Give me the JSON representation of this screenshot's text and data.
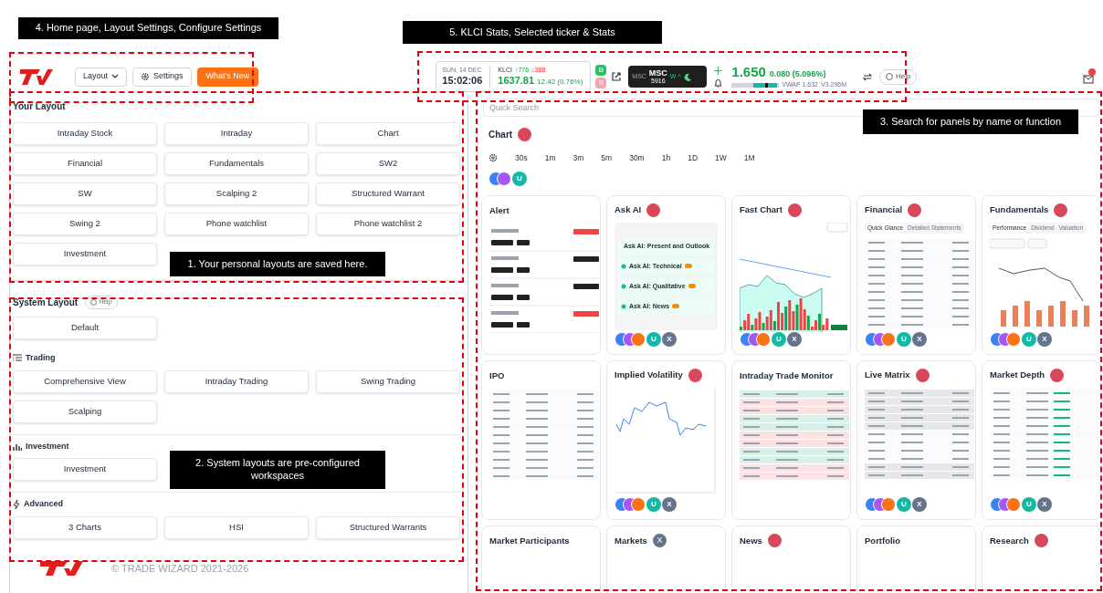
{
  "annotations": [
    {
      "text": "4. Home page, Layout Settings, Configure Settings"
    },
    {
      "text": "5. KLCI Stats, Selected ticker & Stats"
    },
    {
      "text": "3. Search for panels by name or function"
    },
    {
      "text": "1. Your personal layouts are saved here."
    },
    {
      "text": "2. System layouts are pre-configured workspaces"
    }
  ],
  "header": {
    "buttons": [
      {
        "label": "Layout",
        "kind": "dropdown"
      },
      {
        "label": "Settings",
        "kind": "settings"
      },
      {
        "label": "What's New",
        "kind": "primary"
      }
    ],
    "klci": {
      "date": "SUN, 14 DEC",
      "time": "15:02:06",
      "label": "KLCI",
      "up": "↑776",
      "down": "↓388",
      "value": "1637.81",
      "change": "12.42 (0.76%)"
    },
    "trade_badges": [
      {
        "label": "B",
        "color": "#22c55e"
      },
      {
        "label": "S",
        "color": "#f4a3b0"
      }
    ],
    "ticker": {
      "market": "MSC",
      "name": "MSC",
      "code": "5916",
      "flags": "W ^"
    },
    "price": {
      "last": "1.650",
      "change": "0.080 (5.096%)",
      "vwap": "VWAP 1.632",
      "volume": "V3.296M"
    },
    "help": "Help"
  },
  "your_layout": {
    "title": "Your Layout",
    "items": [
      "Intraday Stock",
      "Intraday",
      "Chart",
      "Financial",
      "Fundamentals",
      "SW2",
      "SW",
      "Scalping 2",
      "Structured Warrant",
      "Swing 2",
      "Phone watchlist",
      "Phone watchlist 2",
      "Investment"
    ]
  },
  "system_layout": {
    "title": "System Layout",
    "help": "Help",
    "groups": [
      {
        "items": [
          "Default"
        ]
      },
      {
        "kind": "trading",
        "title": "Trading",
        "items": [
          "Comprehensive View",
          "Intraday Trading",
          "Swing Trading",
          "Scalping"
        ]
      },
      {
        "kind": "investment",
        "title": "Investment",
        "items": [
          "Investment"
        ]
      },
      {
        "kind": "advanced",
        "title": "Advanced",
        "items": [
          "3 Charts",
          "HSI",
          "Structured Warrants"
        ]
      }
    ]
  },
  "footer": {
    "copyright": "© TRADE WIZARD 2021-2026"
  },
  "panels": {
    "search_placeholder": "Quick Search",
    "chart": {
      "title": "Chart",
      "intervals": [
        "30s",
        "1m",
        "3m",
        "5m",
        "30m",
        "1h",
        "1D",
        "1W",
        "1M"
      ],
      "avatars": [
        "U"
      ]
    },
    "cards": [
      {
        "title": "Alert",
        "kind": "list"
      },
      {
        "title": "Ask AI",
        "status_dot": true,
        "kind": "askai",
        "items": [
          "Ask AI: Present and Outlook",
          "Ask AI: Technical",
          "Ask AI: Qualitative",
          "Ask AI: News"
        ],
        "avatars": [
          "U",
          "X"
        ]
      },
      {
        "title": "Fast Chart",
        "status_dot": true,
        "kind": "candles",
        "avatars": [
          "U",
          "X"
        ]
      },
      {
        "title": "Financial",
        "status_dot": true,
        "kind": "table",
        "tabs": [
          {
            "label": "Quick Glance",
            "selected": true
          },
          {
            "label": "Detailed Statements",
            "selected": false
          }
        ],
        "avatars": [
          "U",
          "X"
        ]
      },
      {
        "title": "Fundamentals",
        "status_dot": true,
        "kind": "bars",
        "tabs": [
          {
            "label": "Performance",
            "selected": true
          },
          {
            "label": "Dividend",
            "selected": false
          },
          {
            "label": "Valuation",
            "selected": false
          }
        ],
        "avatars": [
          "U",
          "X"
        ]
      },
      {
        "title": "IPO",
        "kind": "table"
      },
      {
        "title": "Implied Volatility",
        "status_dot": true,
        "kind": "line",
        "avatars": [
          "U",
          "X"
        ]
      },
      {
        "title": "Intraday Trade Monitor",
        "kind": "monitor"
      },
      {
        "title": "Live Matrix",
        "status_dot": true,
        "kind": "matrix",
        "avatars": [
          "U",
          "X"
        ]
      },
      {
        "title": "Market Depth",
        "status_dot": true,
        "kind": "depth",
        "avatars": [
          "U",
          "X"
        ]
      },
      {
        "title": "Market Participants",
        "kind": "empty"
      },
      {
        "title": "Markets",
        "close_badge": "X",
        "kind": "empty"
      },
      {
        "title": "News",
        "status_dot": true,
        "kind": "empty"
      },
      {
        "title": "Portfolio",
        "kind": "empty"
      },
      {
        "title": "Research",
        "status_dot": true,
        "kind": "empty"
      }
    ]
  }
}
